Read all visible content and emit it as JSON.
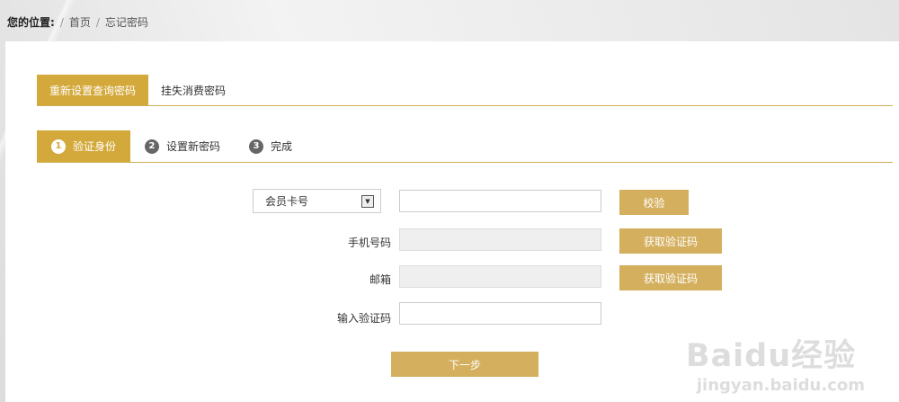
{
  "breadcrumb": {
    "lead": "您的位置:",
    "items": [
      "首页",
      "忘记密码"
    ]
  },
  "tabs": [
    {
      "label": "重新设置查询密码",
      "active": true
    },
    {
      "label": "挂失消费密码",
      "active": false
    }
  ],
  "steps": [
    {
      "num": "1",
      "label": "验证身份",
      "active": true
    },
    {
      "num": "2",
      "label": "设置新密码",
      "active": false
    },
    {
      "num": "3",
      "label": "完成",
      "active": false
    }
  ],
  "form": {
    "id_type": "会员卡号",
    "verify_btn": "校验",
    "phone_label": "手机号码",
    "email_label": "邮箱",
    "code_label": "输入验证码",
    "get_code_btn": "获取验证码",
    "next_btn": "下一步"
  },
  "watermark": {
    "brand": "Baidu经验",
    "url": "jingyan.baidu.com"
  }
}
